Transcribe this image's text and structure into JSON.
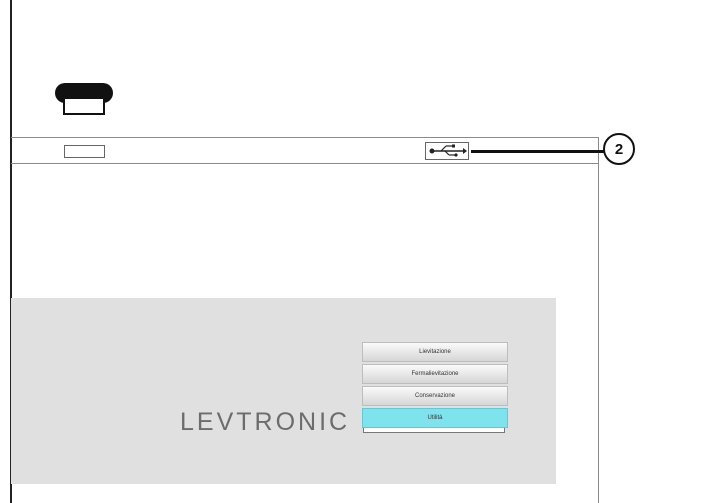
{
  "callout": {
    "number": "2"
  },
  "brand": {
    "logo_text": "LEVTRONIC"
  },
  "menu": {
    "items": [
      {
        "label": "Lievitazione",
        "active": false
      },
      {
        "label": "Fermalievitazione",
        "active": false
      },
      {
        "label": "Conservazione",
        "active": false
      },
      {
        "label": "Utilità",
        "active": true
      }
    ],
    "active_color": "#7fe3ee"
  },
  "icons": {
    "usb": "usb-icon",
    "device": "device-icon"
  },
  "colors": {
    "screen_bg": "#e0e0e0",
    "outline": "#8a8a8a"
  }
}
